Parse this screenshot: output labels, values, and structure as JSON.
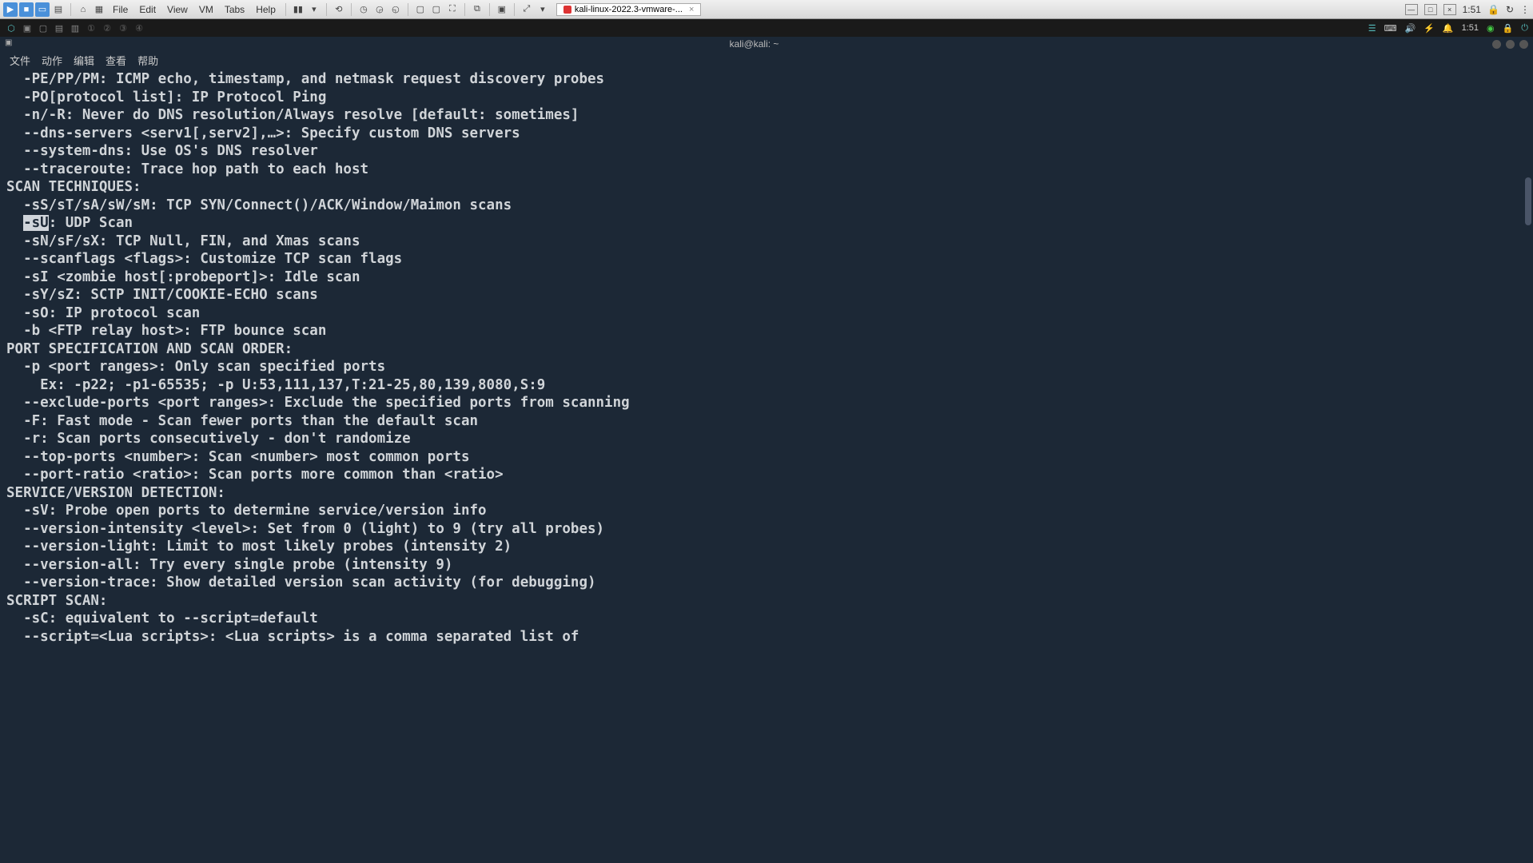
{
  "vm": {
    "menus": [
      "File",
      "Edit",
      "View",
      "VM",
      "Tabs",
      "Help"
    ],
    "tab_label": "kali-linux-2022.3-vmware-...",
    "time": "1:51"
  },
  "kali": {
    "clock": "1:51"
  },
  "terminal": {
    "titlebar_icon": "▣",
    "title": "kali@kali: ~",
    "menus": [
      "文件",
      "动作",
      "编辑",
      "查看",
      "帮助"
    ],
    "lines": [
      "  -PE/PP/PM: ICMP echo, timestamp, and netmask request discovery probes",
      "  -PO[protocol list]: IP Protocol Ping",
      "  -n/-R: Never do DNS resolution/Always resolve [default: sometimes]",
      "  --dns-servers <serv1[,serv2],…>: Specify custom DNS servers",
      "  --system-dns: Use OS's DNS resolver",
      "  --traceroute: Trace hop path to each host",
      "SCAN TECHNIQUES:",
      "  -sS/sT/sA/sW/sM: TCP SYN/Connect()/ACK/Window/Maimon scans",
      {
        "pre": "  ",
        "hl": "-sU",
        "post": ": UDP Scan"
      },
      "  -sN/sF/sX: TCP Null, FIN, and Xmas scans",
      "  --scanflags <flags>: Customize TCP scan flags",
      "  -sI <zombie host[:probeport]>: Idle scan",
      "  -sY/sZ: SCTP INIT/COOKIE-ECHO scans",
      "  -sO: IP protocol scan",
      "  -b <FTP relay host>: FTP bounce scan",
      "PORT SPECIFICATION AND SCAN ORDER:",
      "  -p <port ranges>: Only scan specified ports",
      "    Ex: -p22; -p1-65535; -p U:53,111,137,T:21-25,80,139,8080,S:9",
      "  --exclude-ports <port ranges>: Exclude the specified ports from scanning",
      "  -F: Fast mode - Scan fewer ports than the default scan",
      "  -r: Scan ports consecutively - don't randomize",
      "  --top-ports <number>: Scan <number> most common ports",
      "  --port-ratio <ratio>: Scan ports more common than <ratio>",
      "SERVICE/VERSION DETECTION:",
      "  -sV: Probe open ports to determine service/version info",
      "  --version-intensity <level>: Set from 0 (light) to 9 (try all probes)",
      "  --version-light: Limit to most likely probes (intensity 2)",
      "  --version-all: Try every single probe (intensity 9)",
      "  --version-trace: Show detailed version scan activity (for debugging)",
      "SCRIPT SCAN:",
      "  -sC: equivalent to --script=default",
      "  --script=<Lua scripts>: <Lua scripts> is a comma separated list of"
    ]
  }
}
